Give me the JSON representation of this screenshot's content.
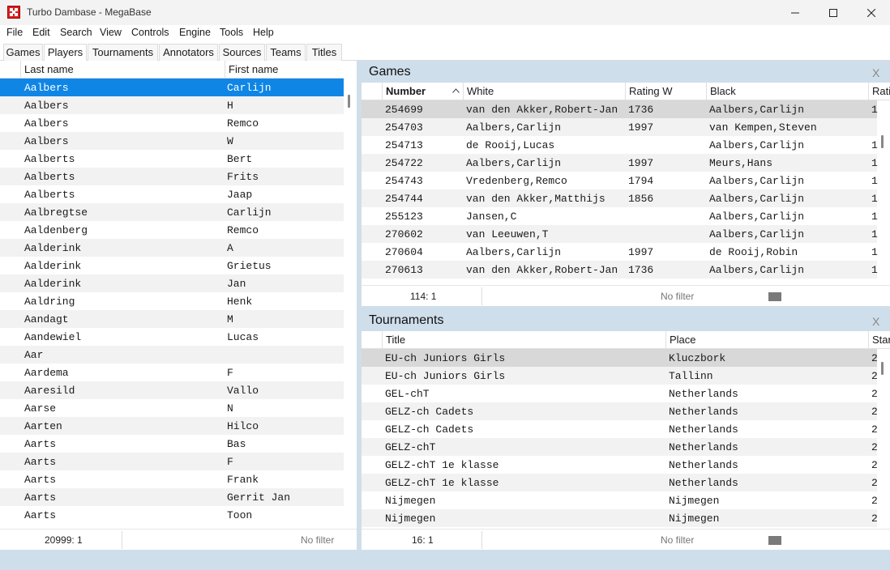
{
  "window": {
    "title": "Turbo Dambase - MegaBase"
  },
  "menu": [
    "File",
    "Edit",
    "Search",
    "View",
    "Controls",
    "Engine",
    "Tools",
    "Help"
  ],
  "tabs": [
    "Games",
    "Players",
    "Tournaments",
    "Annotators",
    "Sources",
    "Teams",
    "Titles"
  ],
  "players": {
    "headers": {
      "last": "Last name",
      "first": "First name"
    },
    "rows": [
      [
        "Aalbers",
        "Carlijn"
      ],
      [
        "Aalbers",
        "H"
      ],
      [
        "Aalbers",
        "Remco"
      ],
      [
        "Aalbers",
        "W"
      ],
      [
        "Aalberts",
        "Bert"
      ],
      [
        "Aalberts",
        "Frits"
      ],
      [
        "Aalberts",
        "Jaap"
      ],
      [
        "Aalbregtse",
        "Carlijn"
      ],
      [
        "Aaldenberg",
        "Remco"
      ],
      [
        "Aalderink",
        "A"
      ],
      [
        "Aalderink",
        "Grietus"
      ],
      [
        "Aalderink",
        "Jan"
      ],
      [
        "Aaldring",
        "Henk"
      ],
      [
        "Aandagt",
        "M"
      ],
      [
        "Aandewiel",
        "Lucas"
      ],
      [
        "Aar",
        ""
      ],
      [
        "Aardema",
        "F"
      ],
      [
        "Aaresild",
        "Vallo"
      ],
      [
        "Aarse",
        "N"
      ],
      [
        "Aarten",
        "Hilco"
      ],
      [
        "Aarts",
        "Bas"
      ],
      [
        "Aarts",
        "F"
      ],
      [
        "Aarts",
        "Frank"
      ],
      [
        "Aarts",
        "Gerrit Jan"
      ],
      [
        "Aarts",
        "Toon"
      ]
    ],
    "status": {
      "count": "20999: 1",
      "filter": "No filter"
    }
  },
  "games": {
    "title": "Games",
    "close": "X",
    "headers": {
      "number": "Number",
      "white": "White",
      "rating_w": "Rating W",
      "black": "Black",
      "rating_b": "Rati"
    },
    "rows": [
      [
        "254699",
        "van den Akker,Robert-Jan",
        "1736",
        "Aalbers,Carlijn",
        "1"
      ],
      [
        "254703",
        "Aalbers,Carlijn",
        "1997",
        "van Kempen,Steven",
        ""
      ],
      [
        "254713",
        "de Rooij,Lucas",
        "",
        "Aalbers,Carlijn",
        "1"
      ],
      [
        "254722",
        "Aalbers,Carlijn",
        "1997",
        "Meurs,Hans",
        "1"
      ],
      [
        "254743",
        "Vredenberg,Remco",
        "1794",
        "Aalbers,Carlijn",
        "1"
      ],
      [
        "254744",
        "van den Akker,Matthijs",
        "1856",
        "Aalbers,Carlijn",
        "1"
      ],
      [
        "255123",
        "Jansen,C",
        "",
        "Aalbers,Carlijn",
        "1"
      ],
      [
        "270602",
        "van Leeuwen,T",
        "",
        "Aalbers,Carlijn",
        "1"
      ],
      [
        "270604",
        "Aalbers,Carlijn",
        "1997",
        "de Rooij,Robin",
        "1"
      ],
      [
        "270613",
        "van den Akker,Robert-Jan",
        "1736",
        "Aalbers,Carlijn",
        "1"
      ]
    ],
    "status": {
      "count": "114: 1",
      "filter": "No filter"
    }
  },
  "tournaments": {
    "title": "Tournaments",
    "close": "X",
    "headers": {
      "title": "Title",
      "place": "Place",
      "start": "Star"
    },
    "rows": [
      [
        "EU-ch Juniors Girls",
        "Kluczbork",
        "2"
      ],
      [
        "EU-ch Juniors Girls",
        "Tallinn",
        "2"
      ],
      [
        "GEL-chT",
        "Netherlands",
        "2"
      ],
      [
        "GELZ-ch Cadets",
        "Netherlands",
        "2"
      ],
      [
        "GELZ-ch Cadets",
        "Netherlands",
        "2"
      ],
      [
        "GELZ-chT",
        "Netherlands",
        "2"
      ],
      [
        "GELZ-chT 1e klasse",
        "Netherlands",
        "2"
      ],
      [
        "GELZ-chT 1e klasse",
        "Netherlands",
        "2"
      ],
      [
        "Nijmegen",
        "Nijmegen",
        "2"
      ],
      [
        "Nijmegen",
        "Nijmegen",
        "2"
      ]
    ],
    "status": {
      "count": "16: 1",
      "filter": "No filter"
    }
  },
  "colors": {
    "selection": "#0f86e6",
    "panel_bg": "#cfdeeb",
    "highlight": "#d8d8d8"
  }
}
